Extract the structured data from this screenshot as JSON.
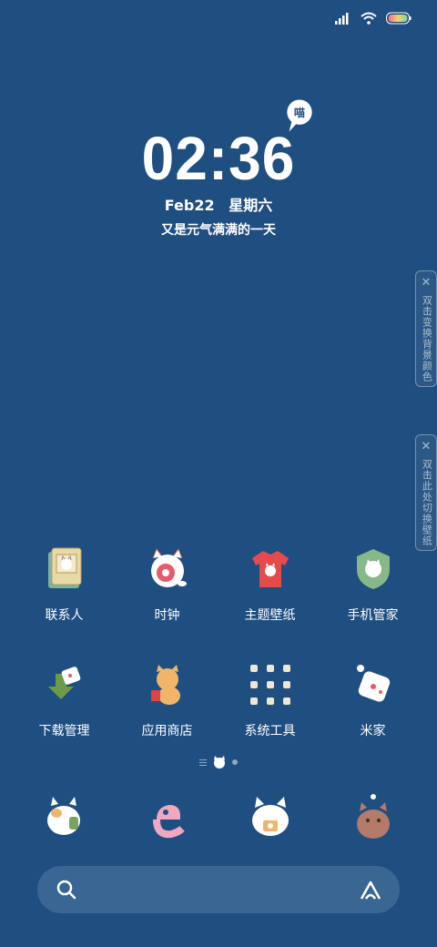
{
  "status_bar": {
    "signal": "signal-icon",
    "wifi": "wifi-icon",
    "battery": "battery-icon"
  },
  "clock": {
    "time": "02:36",
    "date": "Feb22",
    "weekday": "星期六",
    "slogan": "又是元气满满的一天",
    "bubble": "喵"
  },
  "side_tabs": [
    {
      "text": "双击变换背景颜色"
    },
    {
      "text": "双击此处切换壁纸"
    }
  ],
  "apps_row1": [
    {
      "label": "联系人",
      "icon": "contacts-cat-icon"
    },
    {
      "label": "时钟",
      "icon": "clock-cat-icon"
    },
    {
      "label": "主题壁纸",
      "icon": "theme-shirt-icon"
    },
    {
      "label": "手机管家",
      "icon": "security-shield-icon"
    }
  ],
  "apps_row2": [
    {
      "label": "下载管理",
      "icon": "download-cat-icon"
    },
    {
      "label": "应用商店",
      "icon": "app-store-cat-icon"
    },
    {
      "label": "系统工具",
      "icon": "system-tools-grid-icon"
    },
    {
      "label": "米家",
      "icon": "mijia-cat-icon"
    }
  ],
  "dock": [
    {
      "icon": "phone-cat-icon"
    },
    {
      "icon": "browser-e-icon"
    },
    {
      "icon": "camera-cat-icon"
    },
    {
      "icon": "gallery-cat-icon"
    }
  ],
  "colors": {
    "background": "#1f4e80",
    "search_bar": "#3a6694"
  }
}
